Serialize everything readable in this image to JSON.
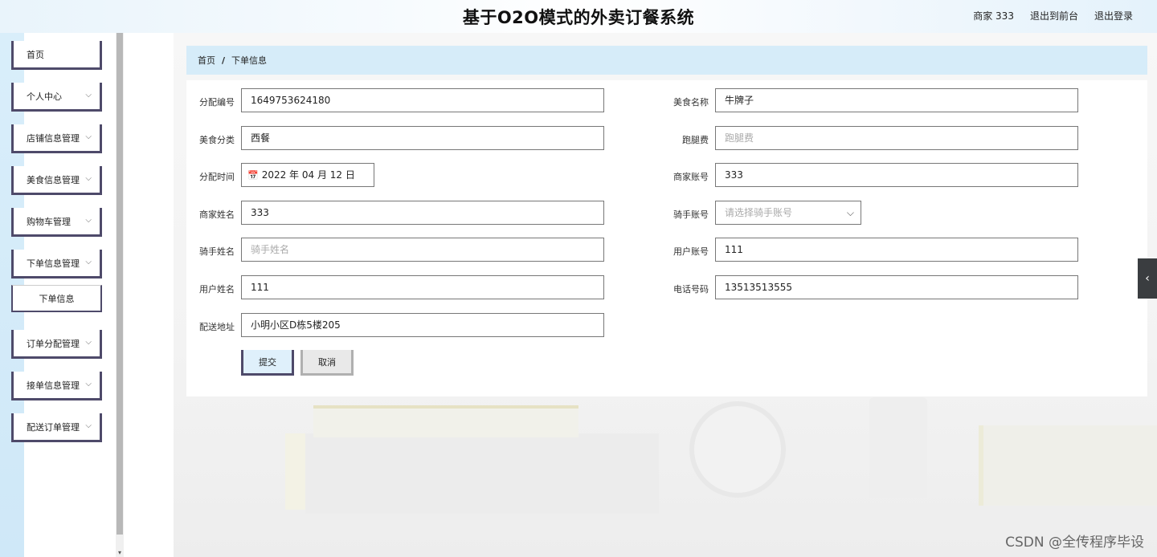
{
  "header": {
    "title": "基于O2O模式的外卖订餐系统",
    "merchant": "商家 333",
    "back_to_front": "退出到前台",
    "logout": "退出登录"
  },
  "sidebar": {
    "items": [
      {
        "label": "首页"
      },
      {
        "label": "个人中心"
      },
      {
        "label": "店铺信息管理"
      },
      {
        "label": "美食信息管理"
      },
      {
        "label": "购物车管理"
      },
      {
        "label": "下单信息管理"
      },
      {
        "label": "下单信息"
      },
      {
        "label": "订单分配管理"
      },
      {
        "label": "接单信息管理"
      },
      {
        "label": "配送订单管理"
      }
    ]
  },
  "breadcrumb": {
    "home": "首页",
    "separator": "/",
    "current": "下单信息"
  },
  "form": {
    "fields": [
      {
        "label": "分配编号",
        "value": "1649753624180"
      },
      {
        "label": "美食名称",
        "value": "牛牌子"
      },
      {
        "label": "美食分类",
        "value": "西餐"
      },
      {
        "label": "跑腿费",
        "placeholder": "跑腿费"
      },
      {
        "label": "分配时间",
        "value": "2022 年 04 月 12 日"
      },
      {
        "label": "商家账号",
        "value": "333"
      },
      {
        "label": "商家姓名",
        "value": "333"
      },
      {
        "label": "骑手账号",
        "placeholder": "请选择骑手账号"
      },
      {
        "label": "骑手姓名",
        "placeholder": "骑手姓名"
      },
      {
        "label": "用户账号",
        "value": "111"
      },
      {
        "label": "用户姓名",
        "value": "111"
      },
      {
        "label": "电话号码",
        "value": "13513513555"
      },
      {
        "label": "配送地址",
        "value": "小明小区D栋5楼205"
      }
    ],
    "submit_label": "提交",
    "cancel_label": "取消"
  },
  "icons": {
    "calendar": "calendar-icon",
    "chevron": "chevron-down-icon",
    "toggle": "chevron-left-icon"
  },
  "watermark": "CSDN @全传程序毕设"
}
